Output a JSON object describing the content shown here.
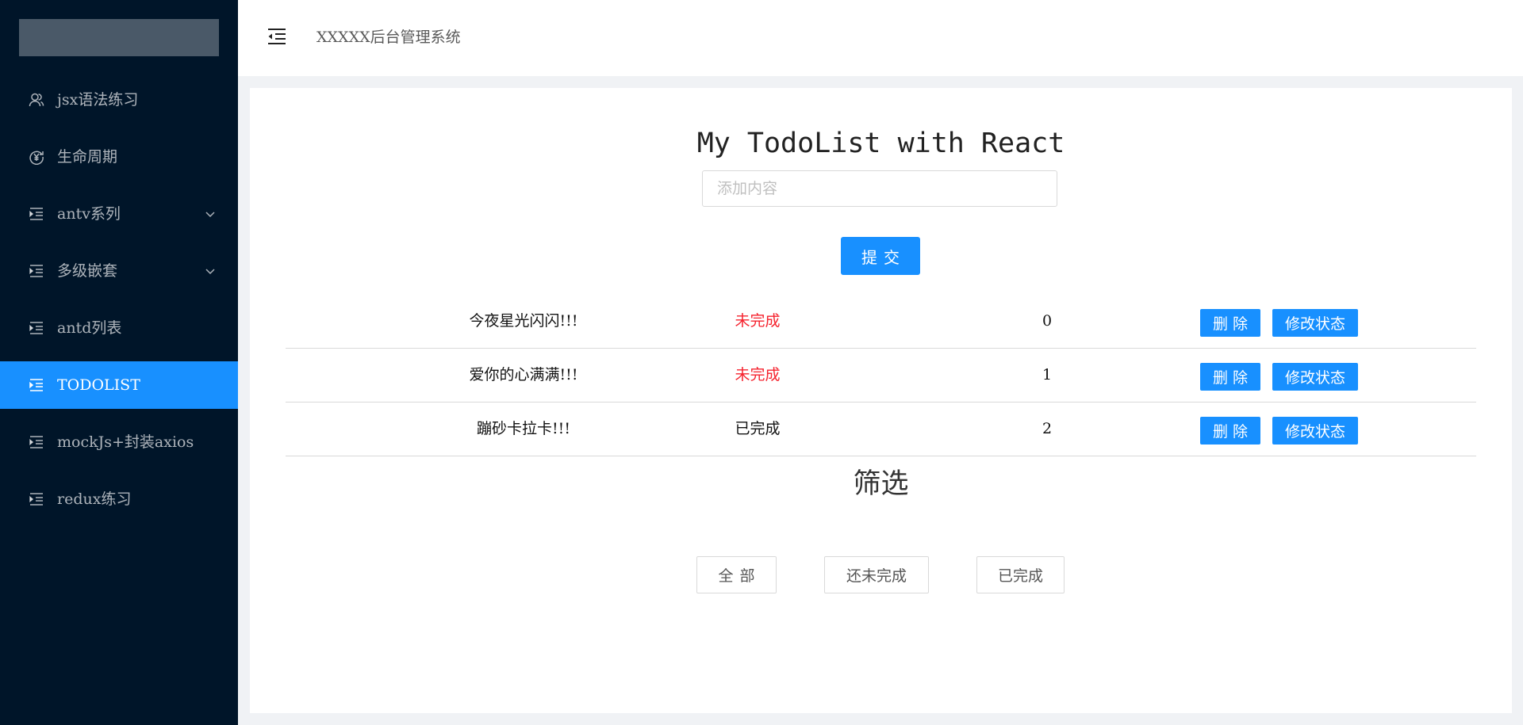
{
  "sidebar": {
    "items": [
      {
        "label": "jsx语法练习",
        "icon": "user-group-icon",
        "has_submenu": false
      },
      {
        "label": "生命周期",
        "icon": "yen-circle-icon",
        "has_submenu": false
      },
      {
        "label": "antv系列",
        "icon": "menu-unfold-icon",
        "has_submenu": true
      },
      {
        "label": "多级嵌套",
        "icon": "menu-unfold-icon",
        "has_submenu": true
      },
      {
        "label": "antd列表",
        "icon": "menu-unfold-icon",
        "has_submenu": false
      },
      {
        "label": "TODOLIST",
        "icon": "menu-unfold-icon",
        "has_submenu": false,
        "active": true
      },
      {
        "label": "mockJs+封装axios",
        "icon": "menu-unfold-icon",
        "has_submenu": false
      },
      {
        "label": "redux练习",
        "icon": "menu-unfold-icon",
        "has_submenu": false
      }
    ]
  },
  "header": {
    "title": "XXXXX后台管理系统",
    "toggle_icon": "menu-fold-icon"
  },
  "todo": {
    "title": "My TodoList with React",
    "input_placeholder": "添加内容",
    "input_value": "",
    "submit_label": "提交",
    "rows": [
      {
        "name": "今夜星光闪闪!!!",
        "status": "未完成",
        "done": false,
        "id": "0",
        "delete_label": "删除",
        "modify_label": "修改状态"
      },
      {
        "name": "爱你的心满满!!!",
        "status": "未完成",
        "done": false,
        "id": "1",
        "delete_label": "删除",
        "modify_label": "修改状态"
      },
      {
        "name": "蹦砂卡拉卡!!!",
        "status": "已完成",
        "done": true,
        "id": "2",
        "delete_label": "删除",
        "modify_label": "修改状态"
      }
    ]
  },
  "filter": {
    "title": "筛选",
    "all_label": "全部",
    "undone_label": "还未完成",
    "done_label": "已完成"
  },
  "colors": {
    "sidebar_bg": "#001529",
    "accent": "#1890ff",
    "undone_text": "#f5222d",
    "page_bg": "#f0f2f5"
  }
}
